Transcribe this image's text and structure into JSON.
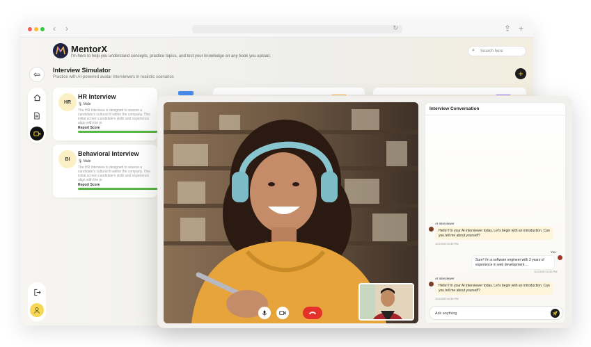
{
  "app": {
    "brand": "MentorX",
    "tagline": "I'm here to help you understand concepts, practice topics, and test your knowledge on any book you upload.",
    "search_placeholder": "Search here"
  },
  "page": {
    "title": "Interview Simulator",
    "subtitle": "Practice with AI-powered avatar interviewers in realistic scenarios"
  },
  "cards": [
    {
      "badge": "HR",
      "title": "HR Interview",
      "gender": "Male",
      "description": "The HR Interview is designed to assess a candidate's cultural fit within the company. This initial screen candidate's skills and experience align with the jo",
      "score_label": "Report Score",
      "tag_color": "#4a8ef0"
    },
    {
      "badge": "BI",
      "title": "Behavioral Interview",
      "gender": "Male",
      "description": "The HR Interview is designed to assess a candidate's cultural fit within the company. This initial screen candidate's skills and experience align with the jo",
      "score_label": "Report Score",
      "tag_color": "#4a8ef0"
    }
  ],
  "chat": {
    "header": "Interview Conversation",
    "messages": [
      {
        "sender": "AI Interviewer",
        "text": "Hello! I'm your AI interviewer today. Let's begin with an introduction. Can you tell me about yourself?",
        "time": "11/10/25 04:30 PM",
        "role": "ai"
      },
      {
        "sender": "You",
        "text": "Sure! I'm a software engineer with 3 years of experience in web development ...",
        "time": "11/10/25 04:30 PM",
        "role": "me"
      },
      {
        "sender": "AI Interviewer",
        "text": "Hello! I'm your AI interviewer today. Let's begin with an introduction. Can you tell me about yourself?",
        "time": "11/10/25 04:30 PM",
        "role": "ai"
      }
    ],
    "input_placeholder": "Ask anything"
  },
  "colors": {
    "accent_yellow": "#f5d430",
    "end_call_red": "#e4322b",
    "progress_green": "#58b646",
    "dark": "#111111"
  },
  "icons": {
    "back": "arrow-left-icon",
    "home": "home-icon",
    "document": "document-icon",
    "video": "video-icon",
    "logout": "logout-icon",
    "user": "user-icon",
    "mic": "mic-icon",
    "camera": "camera-icon",
    "end_call": "phone-hangup-icon",
    "send": "send-icon"
  }
}
